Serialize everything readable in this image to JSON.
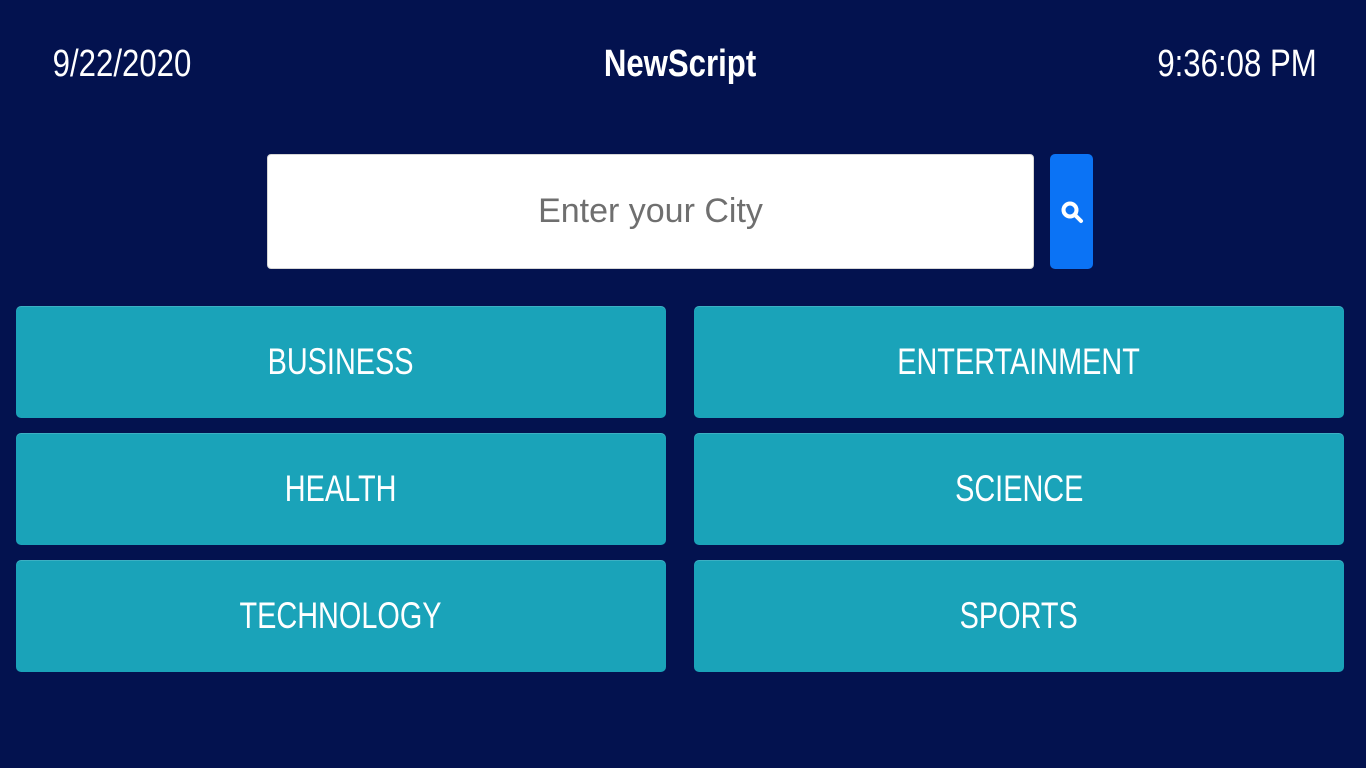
{
  "header": {
    "date": "9/22/2020",
    "title": "NewScript",
    "time": "9:36:08 PM"
  },
  "search": {
    "placeholder": "Enter your City",
    "value": "",
    "button_icon": "search-icon"
  },
  "categories": [
    "BUSINESS",
    "ENTERTAINMENT",
    "HEALTH",
    "SCIENCE",
    "TECHNOLOGY",
    "SPORTS"
  ],
  "colors": {
    "background": "#03124f",
    "category_button": "#1aa3b9",
    "search_button": "#0b73f5",
    "text": "#ffffff"
  }
}
